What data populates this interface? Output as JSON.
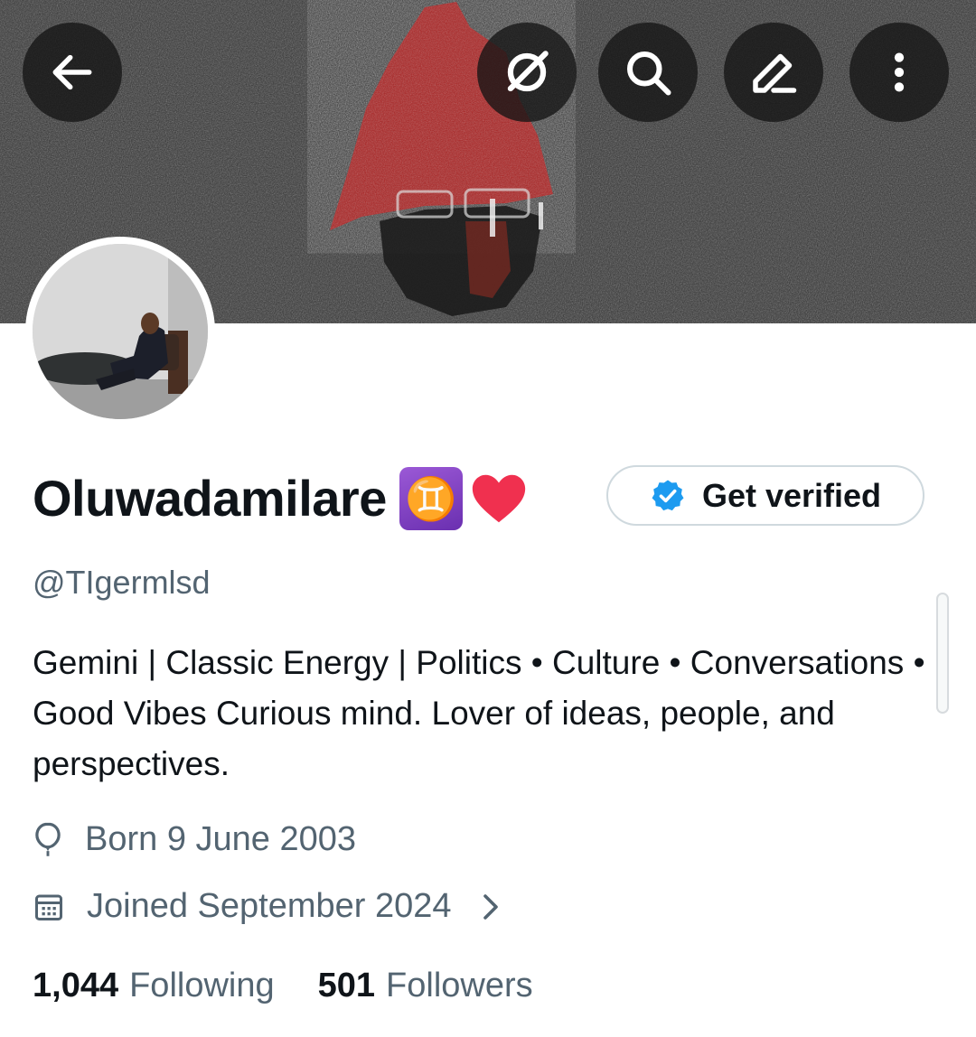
{
  "colors": {
    "accent_blue": "#1d9bf0",
    "text_primary": "#0f1419",
    "text_secondary": "#536471",
    "banner_red": "#c4201f"
  },
  "header": {
    "back_icon": "arrow-left-icon",
    "actions": [
      "grok-icon",
      "search-icon",
      "edit-icon",
      "more-vertical-icon"
    ]
  },
  "profile": {
    "display_name": "Oluwadamilare",
    "name_emojis": [
      "♊",
      "❤️"
    ],
    "gemini_glyph": "♊",
    "handle": "@TIgermlsd",
    "bio": "Gemini | Classic Energy | Politics • Culture • Conversations • Good Vibes Curious mind. Lover of ideas, people, and perspectives.",
    "verify_label": "Get verified",
    "born": "Born 9 June 2003",
    "joined": "Joined September 2024"
  },
  "stats": {
    "following_count": "1,044",
    "following_label": "Following",
    "followers_count": "501",
    "followers_label": "Followers"
  }
}
